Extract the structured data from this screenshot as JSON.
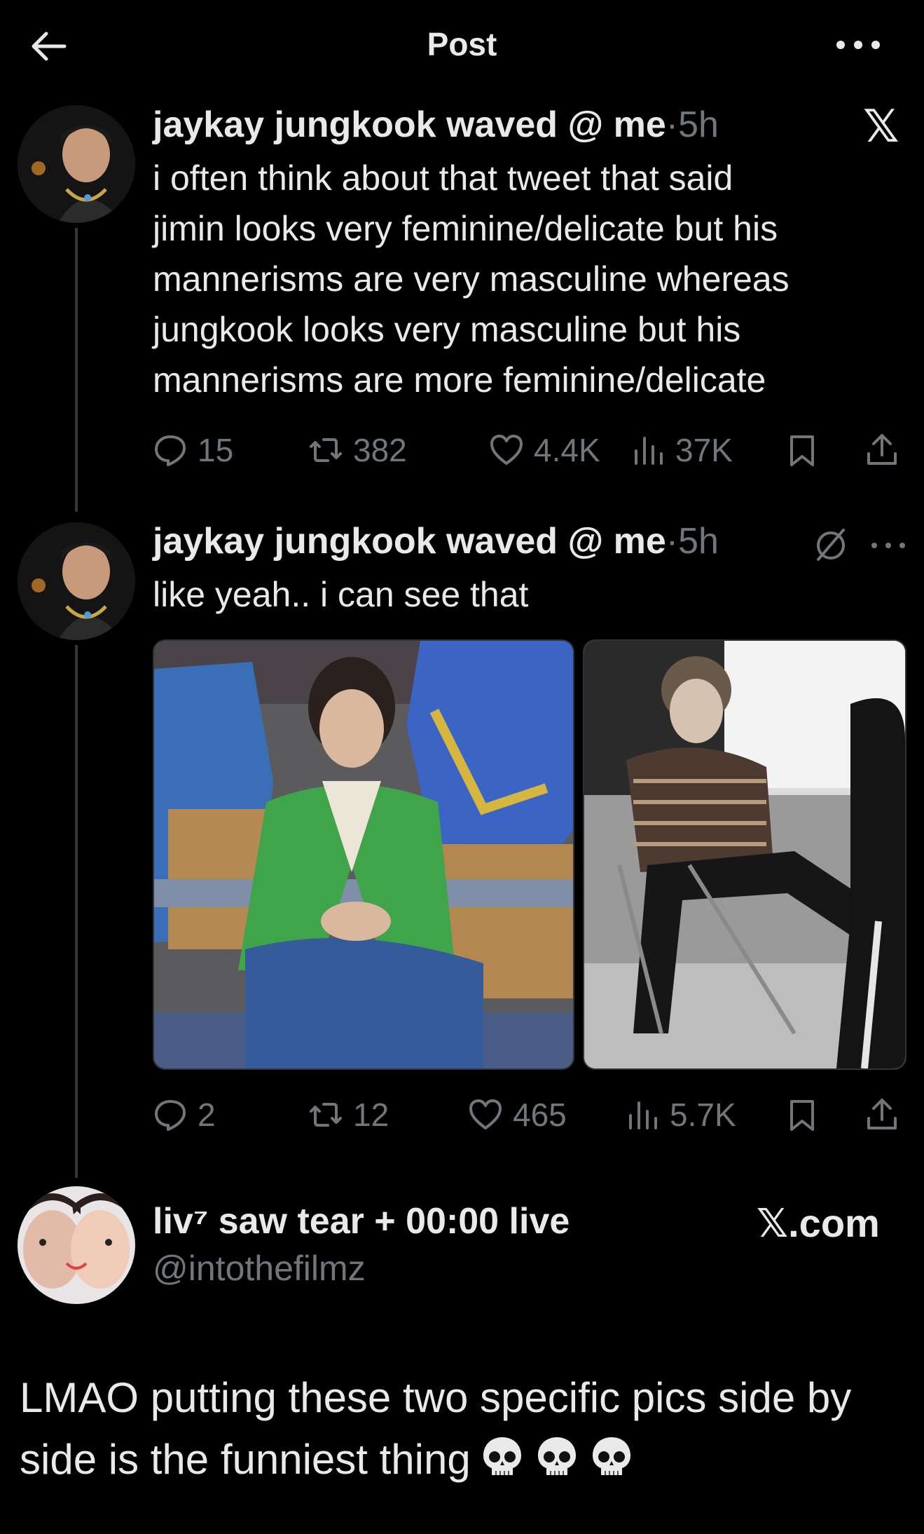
{
  "header": {
    "title": "Post",
    "back_icon": "arrow-left-icon",
    "more_icon": "more-horizontal-icon"
  },
  "tweet1": {
    "author": "jaykay jungkook waved @ me",
    "meta": "·5h",
    "text": "i often think about that tweet that said\njimin looks very feminine/delicate but his\nmannerisms are very masculine whereas\njungkook looks very masculine but his\nmannerisms are more feminine/delicate",
    "replies": "15",
    "reposts": "382",
    "likes": "4.4K",
    "views": "37K",
    "brand_mark": "𝕏"
  },
  "tweet2": {
    "author": "jaykay jungkook waved @ me",
    "meta": "·5h",
    "text": "like yeah.. i can see that",
    "replies": "2",
    "reposts": "12",
    "likes": "465",
    "views": "5.7K"
  },
  "quote": {
    "name": "liv⁷ saw tear + 00:00 live",
    "handle": "@intothefilmz",
    "site": "𝕏.com",
    "body": "LMAO putting these two specific pics side by side is the funniest thing"
  },
  "colors": {
    "background": "#000000",
    "text": "#e7e9ea",
    "muted": "#71767b",
    "divider": "#333639"
  }
}
